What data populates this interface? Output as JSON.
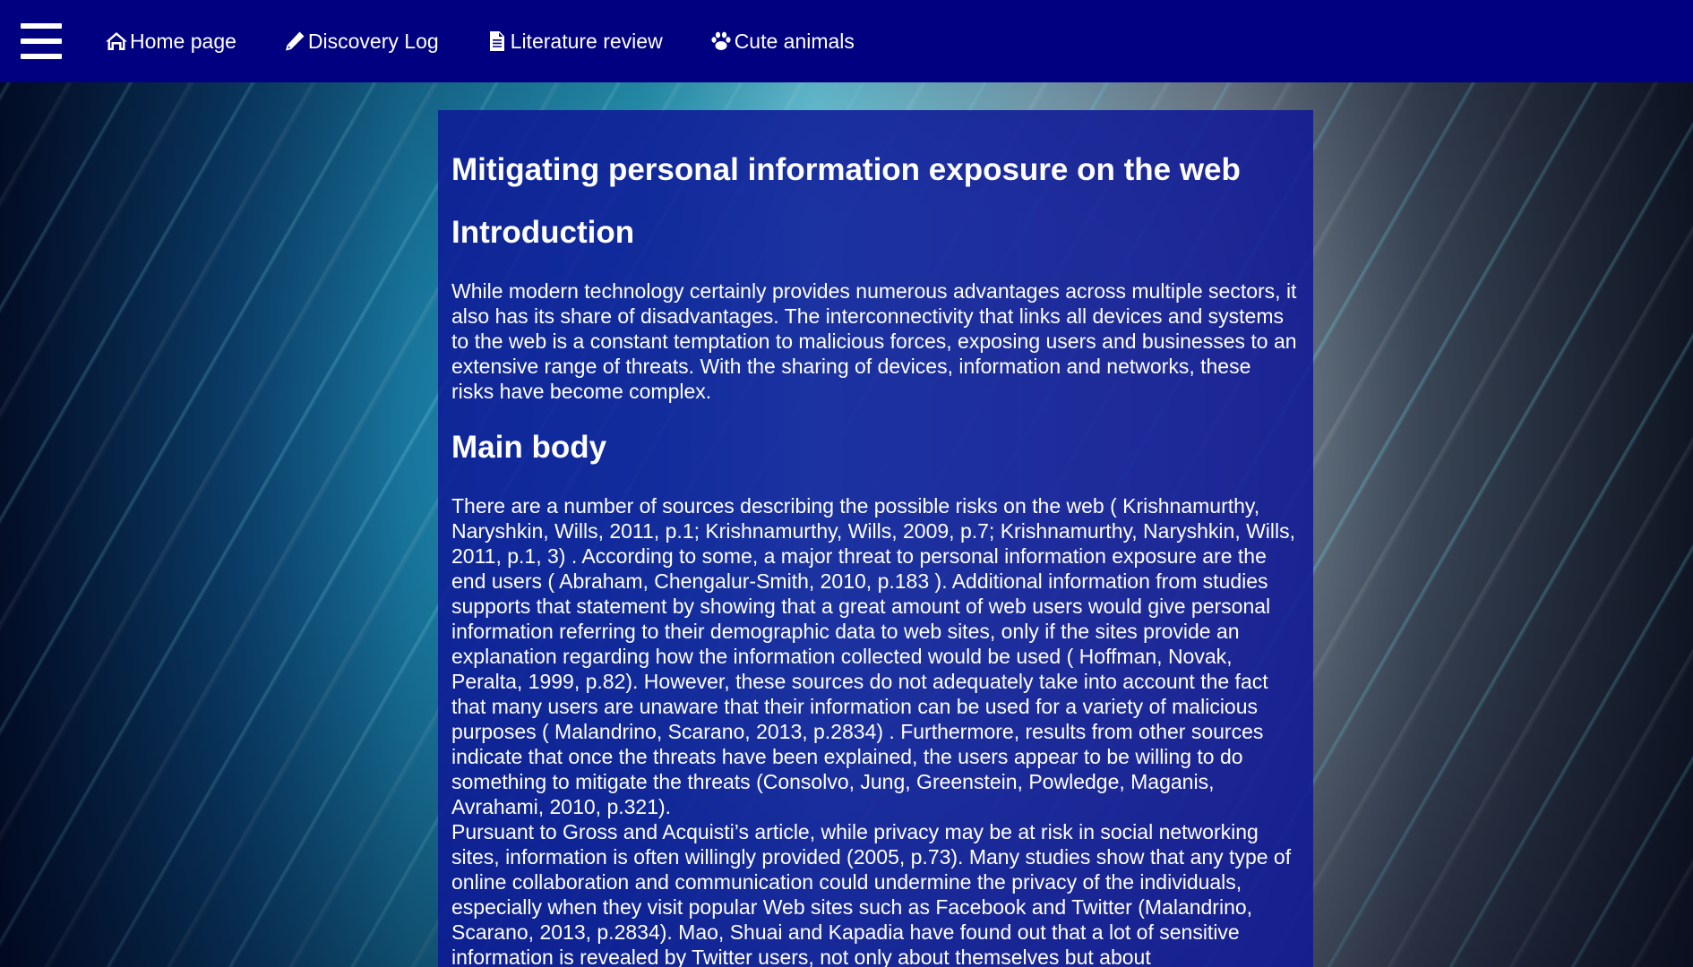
{
  "nav": {
    "menu_icon": "hamburger-menu-icon",
    "items": [
      {
        "label": "Home page",
        "icon": "home-icon"
      },
      {
        "label": "Discovery Log",
        "icon": "pencil-icon"
      },
      {
        "label": "Literature review",
        "icon": "document-icon"
      },
      {
        "label": "Cute animals",
        "icon": "paw-icon"
      }
    ]
  },
  "article": {
    "title": "Mitigating personal information exposure on the web",
    "intro_heading": "Introduction",
    "intro_text": "While modern technology certainly provides numerous advantages across multiple sectors, it also has its share of disadvantages. The interconnectivity that links all devices and systems to the web is a constant temptation to malicious forces, exposing users and businesses to an extensive range of threats. With the sharing of devices, information and networks, these risks have become complex.",
    "body_heading": "Main body",
    "body_paragraph_1": "There are a number of sources describing the possible risks on the web ( Krishnamurthy, Naryshkin, Wills, 2011, p.1; Krishnamurthy, Wills, 2009, p.7; Krishnamurthy, Naryshkin, Wills, 2011, p.1, 3) . According to some, a major threat to personal information exposure are the end users ( Abraham, Chengalur-Smith, 2010, p.183 ). Additional information from studies supports that statement by showing that a great amount of web users would give personal information referring to their demographic data to web sites, only if the sites provide an explanation regarding how the information collected would be used ( Hoffman, Novak, Peralta, 1999, p.82). However, these sources do not adequately take into account the fact that many users are unaware that their information can be used for a variety of malicious purposes ( Malandrino, Scarano, 2013, p.2834) . Furthermore, results from other sources indicate that once the threats have been explained, the users appear to be willing to do something to mitigate the threats (Consolvo, Jung, Greenstein, Powledge, Maganis, Avrahami, 2010, p.321).",
    "body_paragraph_2": "Pursuant to Gross and Acquisti’s article, while privacy may be at risk in social networking sites, information is often willingly provided (2005, p.73). Many studies show that any type of online collaboration and communication could undermine the privacy of the individuals, especially when they visit popular Web sites such as Facebook and Twitter (Malandrino, Scarano, 2013, p.2834). Mao, Shuai and Kapadia have found out that a lot of sensitive information is revealed by Twitter users, not only about themselves but about"
  }
}
